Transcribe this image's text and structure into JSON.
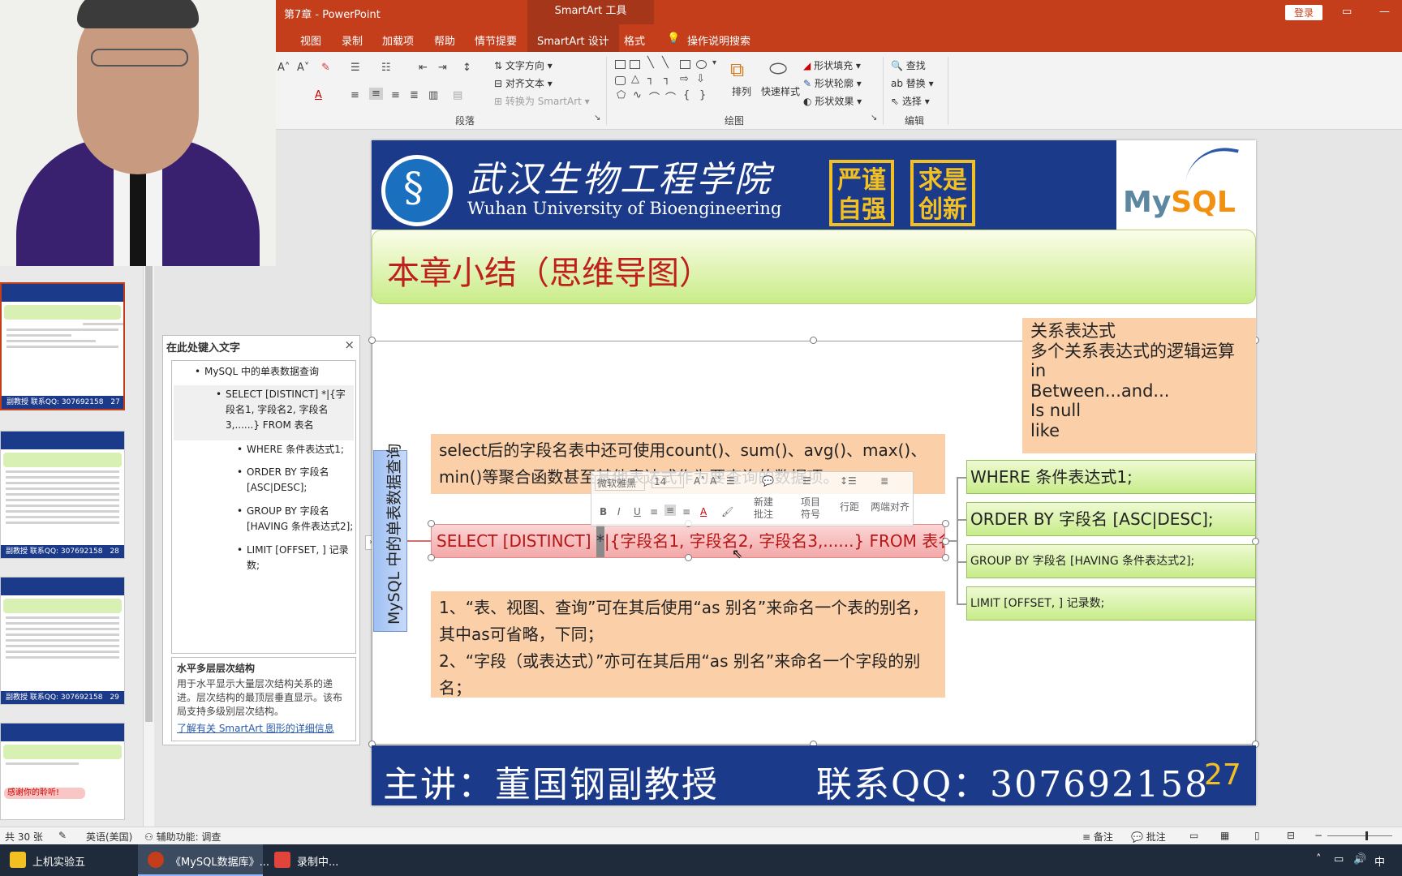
{
  "window": {
    "title": "第7章 - PowerPoint",
    "tool_tab": "SmartArt 工具",
    "login": "登录"
  },
  "tabs": [
    "视图",
    "录制",
    "加载项",
    "帮助",
    "情节提要",
    "SmartArt 设计",
    "格式",
    "操作说明搜索"
  ],
  "ribbon": {
    "paragraph_group": "段落",
    "drawing_group": "绘图",
    "editing_group": "编辑",
    "text_direction": "文字方向",
    "align_text": "对齐文本",
    "convert_smartart": "转换为 SmartArt",
    "arrange": "排列",
    "quick_styles": "快速样式",
    "shape_fill": "形状填充",
    "shape_outline": "形状轮廓",
    "shape_effects": "形状效果",
    "find": "查找",
    "replace": "替换",
    "select": "选择"
  },
  "thumbnails": {
    "footer_text": "副教授      联系QQ: 307692158",
    "numbers": [
      "27",
      "28",
      "29"
    ],
    "last_slide_text": "感谢你的聆听!"
  },
  "text_pane": {
    "title": "在此处键入文字",
    "items": [
      "MySQL 中的单表数据查询",
      "SELECT [DISTINCT] *|{字段名1, 字段名2, 字段名3,......} FROM 表名",
      "WHERE 条件表达式1;",
      "ORDER BY 字段名 [ASC|DESC];",
      "GROUP BY 字段名 [HAVING 条件表达式2];",
      "LIMIT [OFFSET, ] 记录数;"
    ],
    "desc_title": "水平多层层次结构",
    "desc_body": "用于水平显示大量层次结构关系的递进。层次结构的最顶层垂直显示。该布局支持多级别层次结构。",
    "desc_link": "了解有关 SmartArt 图形的详细信息"
  },
  "slide": {
    "university_cn": "武汉生物工程学院",
    "university_en": "Wuhan University of Bioengineering",
    "motto1": "严谨自强",
    "motto2": "求是创新",
    "logo_text_my": "My",
    "logo_text_sql": "SQL",
    "title": "本章小结（思维导图）",
    "relational_lines": [
      "关系表达式",
      "多个关系表达式的逻辑运算",
      "in",
      "Between...and...",
      "Is null",
      "like"
    ],
    "note_aggregate": "select后的字段名表中还可使用count()、sum()、avg()、max()、min()等聚合函数甚至其他表达式作为要查询的数据项。",
    "vertical_label": "MySQL 中的单表数据查询",
    "select_prefix": "SELECT  [DISTINCT] ",
    "select_cursor": "*",
    "select_rest": "|{字段名1, 字段名2, 字段名3,......}  FROM 表名",
    "where": "WHERE 条件表达式1;",
    "order": "ORDER BY 字段名 [ASC|DESC];",
    "group": "GROUP BY 字段名 [HAVING 条件表达式2];",
    "limit": "LIMIT [OFFSET, ] 记录数;",
    "note_alias_1": "1、“表、视图、查询”可在其后使用“as 别名”来命名一个表的别名，其中as可省略，下同；",
    "note_alias_2": "2、“字段（或表达式）”亦可在其后用“as 别名”来命名一个字段的别名；",
    "lecturer": "主讲：董国钢副教授",
    "contact": "联系QQ：307692158",
    "page_number": "27"
  },
  "mini_toolbar": {
    "font": "微软雅黑",
    "size": "14",
    "new_comment": "新建批注",
    "bullets": "项目符号",
    "line_spacing": "行距",
    "justify": "两端对齐"
  },
  "statusbar": {
    "slide_count": "共 30 张",
    "language": "英语(美国)",
    "accessibility": "辅助功能: 调查",
    "notes": "备注",
    "comments": "批注"
  },
  "taskbar": {
    "items": [
      "上机实验五",
      "《MySQL数据库》...",
      "录制中..."
    ],
    "ime": "中"
  },
  "colors": {
    "accent": "#c43e1c",
    "slide_blue": "#1b3a8a",
    "title_red": "#c0201c",
    "motto_gold": "#f2c023"
  }
}
